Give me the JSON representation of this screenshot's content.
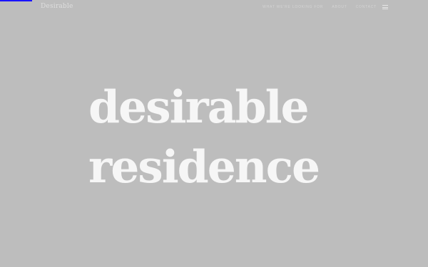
{
  "progress": {
    "fraction": 0.075,
    "color": "#1a14ff"
  },
  "header": {
    "logo_text": "Desirable",
    "nav": [
      {
        "label": "WHAT WE'RE LOOKING FOR"
      },
      {
        "label": "ABOUT"
      },
      {
        "label": "CONTACT"
      }
    ],
    "menu_icon": "hamburger-menu-icon"
  },
  "hero": {
    "line1": "desirable",
    "line2": "residence"
  },
  "colors": {
    "background": "#bdbdbd",
    "hero_text": "#f6f6f6"
  }
}
